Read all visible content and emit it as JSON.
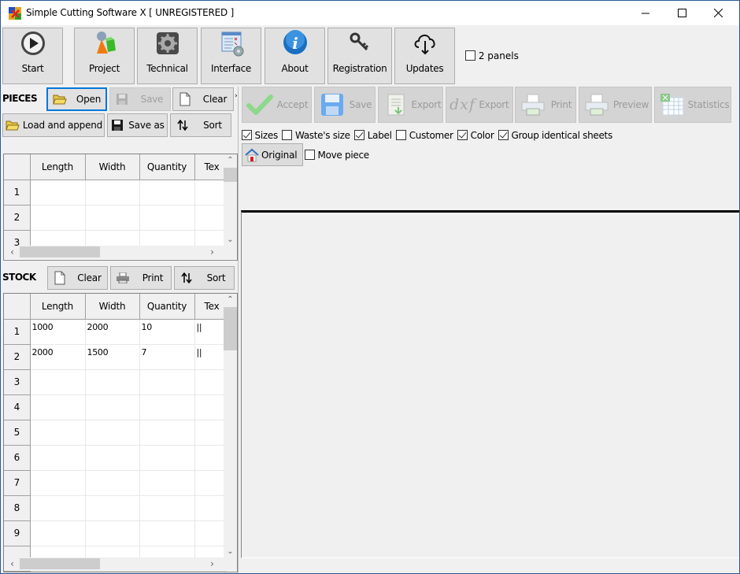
{
  "window": {
    "title": "Simple Cutting Software X [ UNREGISTERED ]",
    "controls": {
      "minimize": "minimize-icon",
      "maximize": "maximize-icon",
      "close": "close-icon"
    }
  },
  "toolbar": {
    "buttons": [
      {
        "label": "Start",
        "icon": "play-icon"
      },
      {
        "label": "Project",
        "icon": "project-shapes-icon"
      },
      {
        "label": "Technical",
        "icon": "gear-icon"
      },
      {
        "label": "Interface",
        "icon": "interface-settings-icon"
      },
      {
        "label": "About",
        "icon": "info-icon"
      },
      {
        "label": "Registration",
        "icon": "key-icon"
      },
      {
        "label": "Updates",
        "icon": "cloud-download-icon"
      }
    ],
    "two_panels": {
      "label": "2 panels",
      "checked": false
    }
  },
  "pieces": {
    "title": "PIECES",
    "open_label": "Open",
    "save_label": "Save",
    "clear_label": "Clear",
    "load_append_label": "Load and append",
    "save_as_label": "Save as",
    "sort_label": "Sort",
    "columns": [
      "Length",
      "Width",
      "Quantity",
      "Tex"
    ],
    "rows": [
      {
        "num": "1",
        "cells": [
          "",
          "",
          "",
          ""
        ]
      },
      {
        "num": "2",
        "cells": [
          "",
          "",
          "",
          ""
        ]
      },
      {
        "num": "3",
        "cells": [
          "",
          "",
          "",
          ""
        ]
      }
    ]
  },
  "stock": {
    "title": "STOCK",
    "clear_label": "Clear",
    "print_label": "Print",
    "sort_label": "Sort",
    "columns": [
      "Length",
      "Width",
      "Quantity",
      "Tex"
    ],
    "rows": [
      {
        "num": "1",
        "cells": [
          "1000",
          "2000",
          "10",
          "||"
        ]
      },
      {
        "num": "2",
        "cells": [
          "2000",
          "1500",
          "7",
          "||"
        ]
      },
      {
        "num": "3",
        "cells": [
          "",
          "",
          "",
          ""
        ]
      },
      {
        "num": "4",
        "cells": [
          "",
          "",
          "",
          ""
        ]
      },
      {
        "num": "5",
        "cells": [
          "",
          "",
          "",
          ""
        ]
      },
      {
        "num": "6",
        "cells": [
          "",
          "",
          "",
          ""
        ]
      },
      {
        "num": "7",
        "cells": [
          "",
          "",
          "",
          ""
        ]
      },
      {
        "num": "8",
        "cells": [
          "",
          "",
          "",
          ""
        ]
      },
      {
        "num": "9",
        "cells": [
          "",
          "",
          "",
          ""
        ]
      }
    ]
  },
  "result": {
    "accept_label": "Accept",
    "save_label": "Save",
    "export_label": "Export",
    "dxf_label": "dxf",
    "dxf_export_label": "Export",
    "print_label": "Print",
    "preview_label": "Preview",
    "statistics_label": "Statistics",
    "options": [
      {
        "label": "Sizes",
        "checked": true
      },
      {
        "label": "Waste's size",
        "checked": false
      },
      {
        "label": "Label",
        "checked": true
      },
      {
        "label": "Customer",
        "checked": false
      },
      {
        "label": "Color",
        "checked": true
      },
      {
        "label": "Group identical sheets",
        "checked": true
      }
    ],
    "original_label": "Original",
    "move_piece": {
      "label": "Move piece",
      "checked": false
    }
  },
  "colors": {
    "accent": "#0078d7",
    "window_border": "#2b5797",
    "background": "#f0f0f0"
  }
}
